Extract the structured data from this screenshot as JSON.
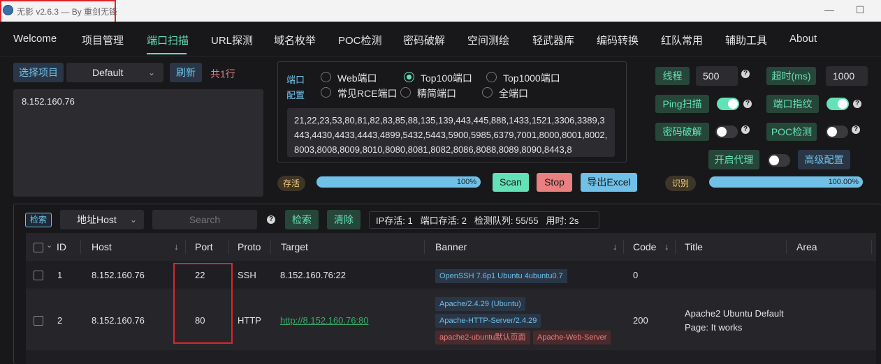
{
  "titlebar": {
    "title": "无影 v2.6.3 — By 重剑无锋",
    "minimize": "—",
    "maximize": "☐"
  },
  "nav": {
    "items": [
      "Welcome",
      "项目管理",
      "端口扫描",
      "URL探测",
      "域名枚举",
      "POC检测",
      "密码破解",
      "空间测绘",
      "轻武器库",
      "编码转换",
      "红队常用",
      "辅助工具",
      "About"
    ],
    "active_index": 2
  },
  "project": {
    "select_label": "选择项目",
    "selected": "Default",
    "refresh_label": "刷新",
    "count_text": "共1行",
    "targets": "8.152.160.76"
  },
  "ports": {
    "group_label_1": "端口",
    "group_label_2": "配置",
    "options": [
      "Web端口",
      "Top100端口",
      "Top1000端口",
      "常见RCE端口",
      "精简端口",
      "全端口"
    ],
    "selected": "Top100端口",
    "port_list": "21,22,23,53,80,81,82,83,85,88,135,139,443,445,888,1433,1521,3306,3389,3443,4430,4433,4443,4899,5432,5443,5900,5985,6379,7001,8000,8001,8002,8003,8008,8009,8010,8080,8081,8082,8086,8088,8089,8090,8443,8"
  },
  "progress": {
    "alive_label": "存活",
    "alive_percent": "100%",
    "alive_value": 1.0,
    "identify_label": "识别",
    "identify_percent": "100.00%",
    "identify_value": 1.0
  },
  "actions": {
    "scan": "Scan",
    "stop": "Stop",
    "export": "导出Excel"
  },
  "settings": {
    "threads_label": "线程",
    "threads_value": "500",
    "timeout_label": "超时(ms)",
    "timeout_value": "1000",
    "ping_label": "Ping扫描",
    "ping_on": true,
    "fingerprint_label": "端口指纹",
    "fingerprint_on": true,
    "crack_label": "密码破解",
    "crack_on": false,
    "poc_label": "POC检测",
    "poc_on": false,
    "proxy_label": "开启代理",
    "proxy_on": false,
    "advanced_label": "高级配置"
  },
  "filter": {
    "search_label": "检索",
    "field": "地址Host",
    "placeholder": "Search",
    "search_button": "检索",
    "clear_button": "清除",
    "stats": "IP存活: 1   端口存活: 2   检测队列: 55/55   用时: 2s"
  },
  "table": {
    "headers": [
      "ID",
      "Host",
      "Port",
      "Proto",
      "Target",
      "Banner",
      "Code",
      "Title",
      "Area"
    ],
    "rows": [
      {
        "id": "1",
        "host": "8.152.160.76",
        "port": "22",
        "proto": "SSH",
        "target": "8.152.160.76:22",
        "banners": [
          "OpenSSH 7.6p1 Ubuntu 4ubuntu0.7"
        ],
        "code": "0",
        "title": ""
      },
      {
        "id": "2",
        "host": "8.152.160.76",
        "port": "80",
        "proto": "HTTP",
        "target": "http://8.152.160.76:80",
        "banners": [
          "Apache/2.4.29 (Ubuntu)",
          "Apache-HTTP-Server/2.4.29",
          "apache2-ubuntu默认页面",
          "Apache-Web-Server"
        ],
        "code": "200",
        "title_line1": "Apache2 Ubuntu Default",
        "title_line2": "Page: It works"
      }
    ]
  },
  "colors": {
    "accent": "#63e2b7",
    "info": "#70c0e8",
    "danger": "#e88080",
    "highlight": "#e0242a"
  }
}
